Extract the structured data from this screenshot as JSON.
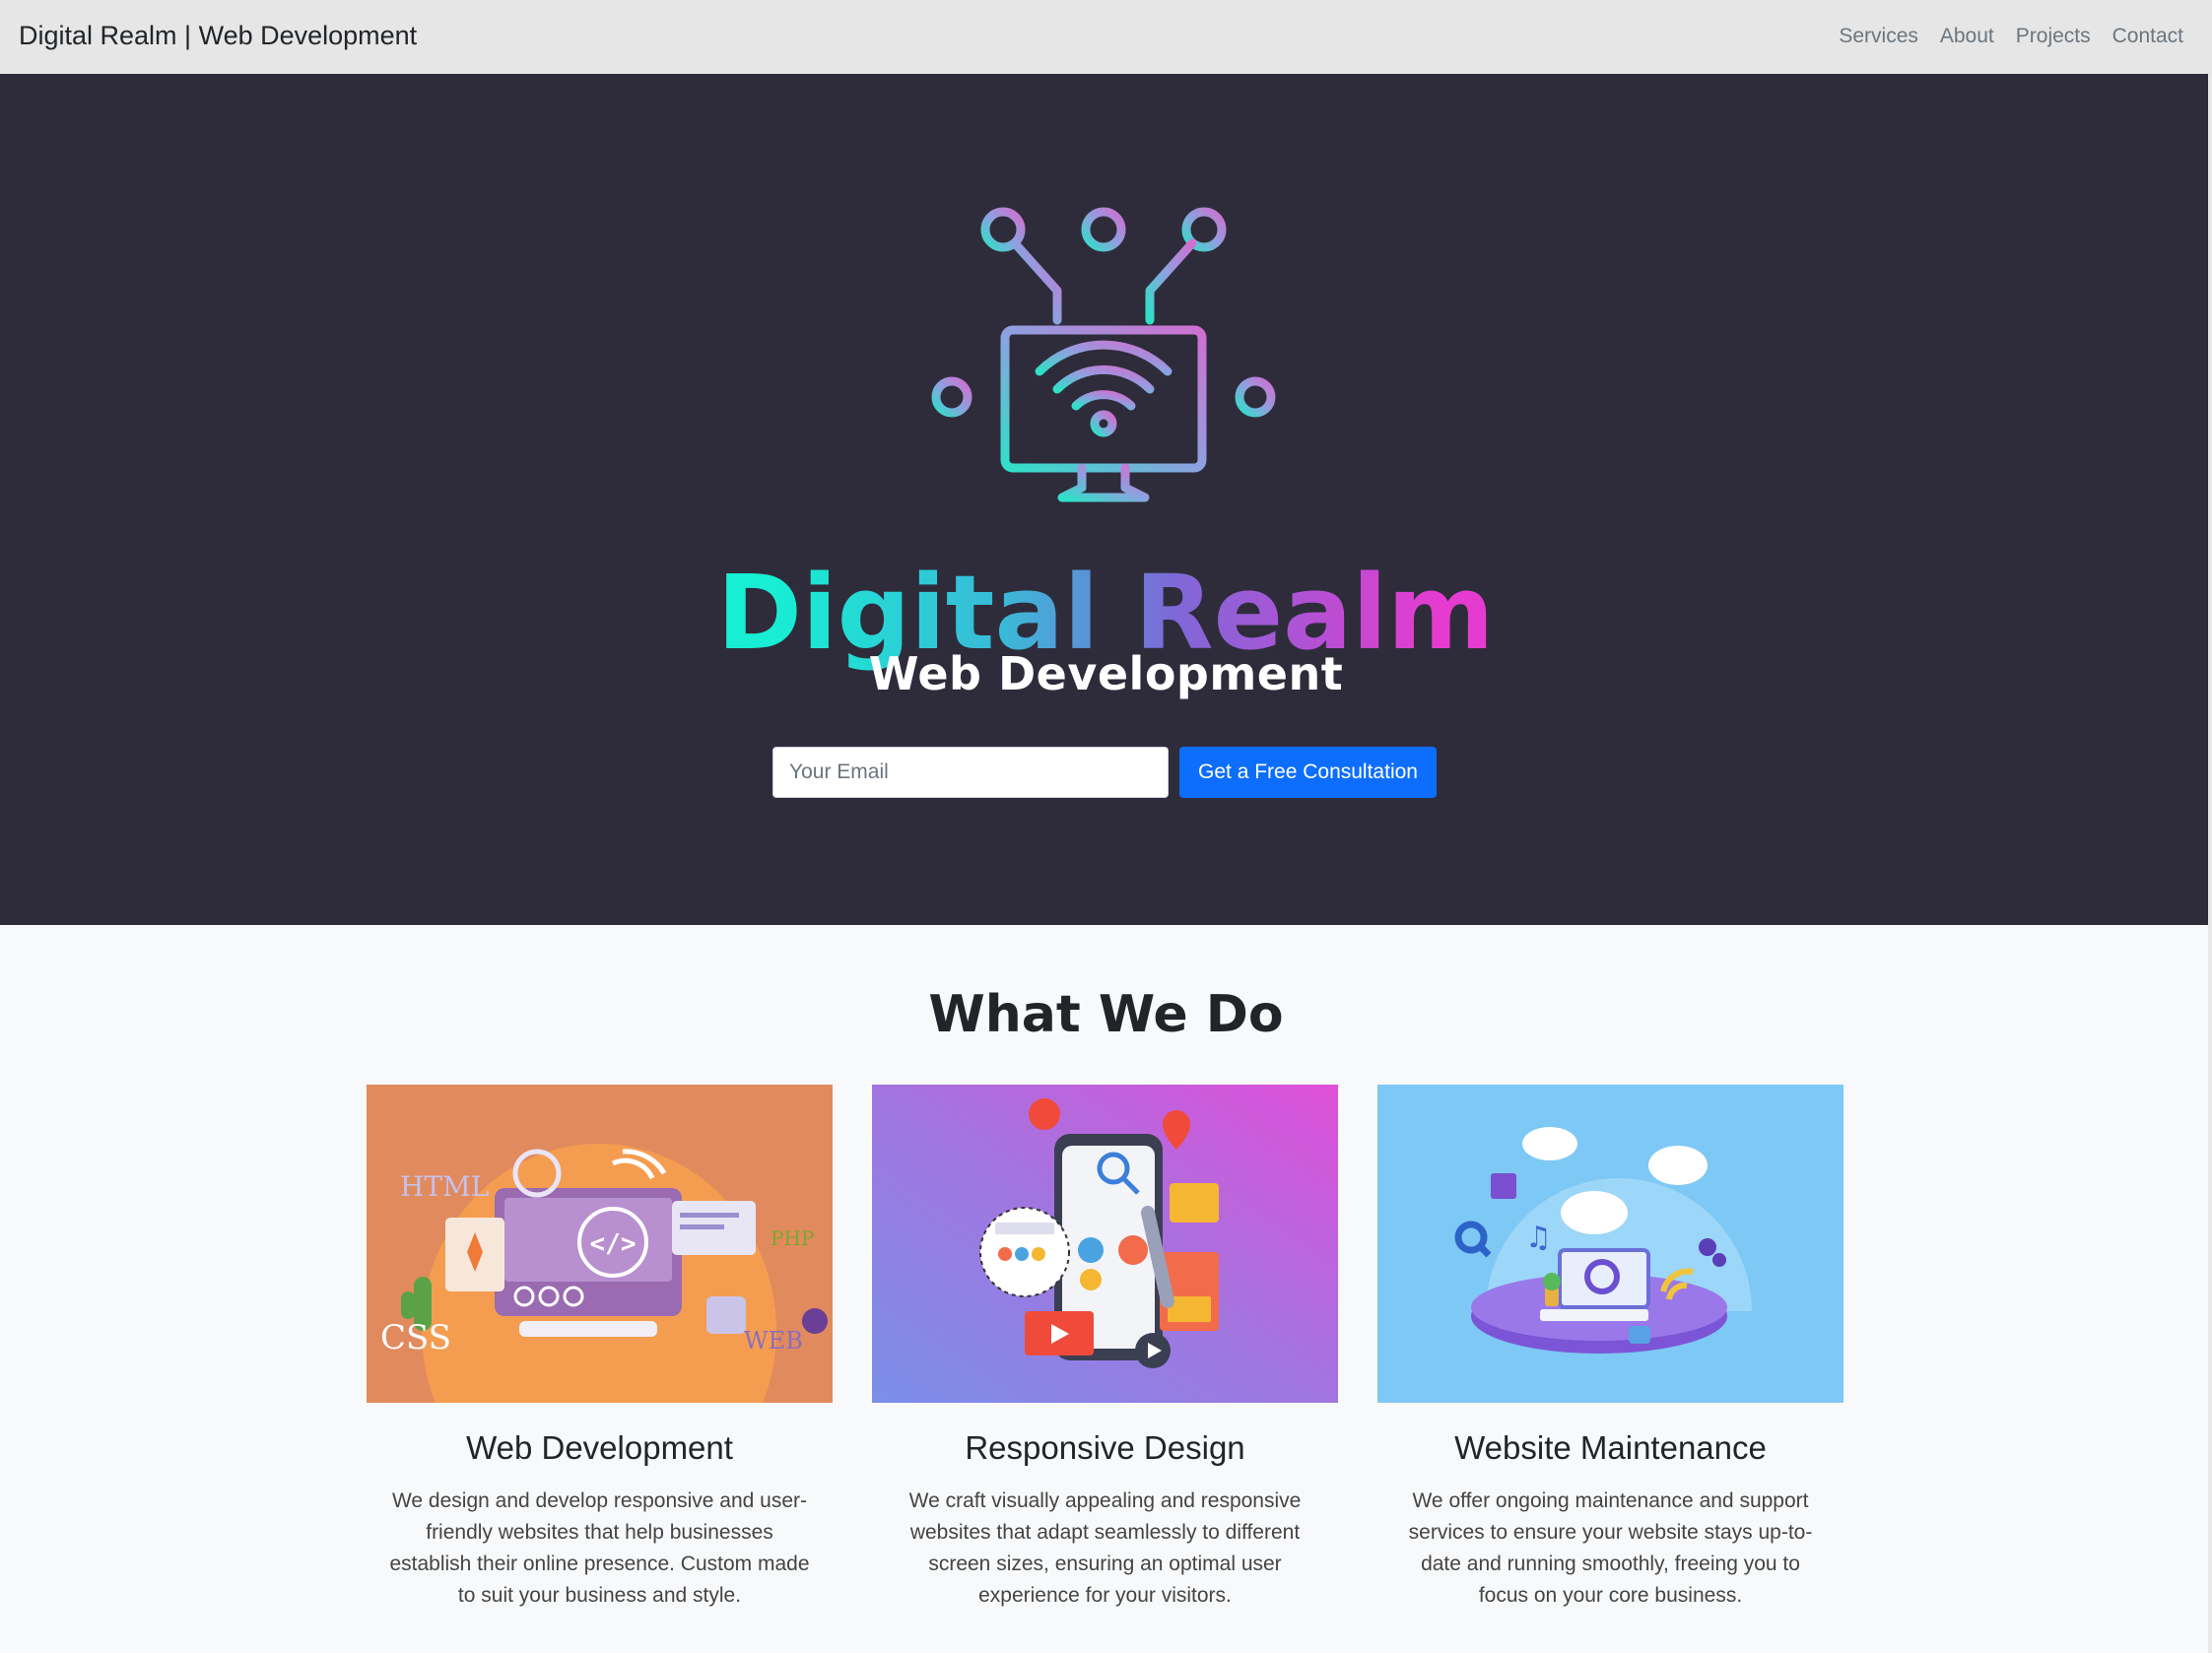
{
  "navbar": {
    "brand": "Digital Realm | Web Development",
    "links": [
      "Services",
      "About",
      "Projects",
      "Contact"
    ]
  },
  "hero": {
    "logo_icon": "monitor-wifi-circuit-icon",
    "title": "Digital Realm",
    "subtitle": "Web Development",
    "email_placeholder": "Your Email",
    "cta_label": "Get a Free Consultation",
    "colors": {
      "background": "#2e2c3b",
      "gradient_start": "#22e6cf",
      "gradient_mid": "#7d69d8",
      "gradient_end": "#e040c9",
      "button": "#0d6efd"
    }
  },
  "services": {
    "title": "What We Do",
    "cards": [
      {
        "illustration": "web-development-illustration",
        "title": "Web Development",
        "description": "We design and develop responsive and user-friendly websites that help businesses establish their online presence. Custom made to suit your business and style."
      },
      {
        "illustration": "responsive-design-illustration",
        "title": "Responsive Design",
        "description": "We craft visually appealing and responsive websites that adapt seamlessly to different screen sizes, ensuring an optimal user experience for your visitors."
      },
      {
        "illustration": "website-maintenance-illustration",
        "title": "Website Maintenance",
        "description": "We offer ongoing maintenance and support services to ensure your website stays up-to-date and running smoothly, freeing you to focus on your core business."
      }
    ]
  }
}
